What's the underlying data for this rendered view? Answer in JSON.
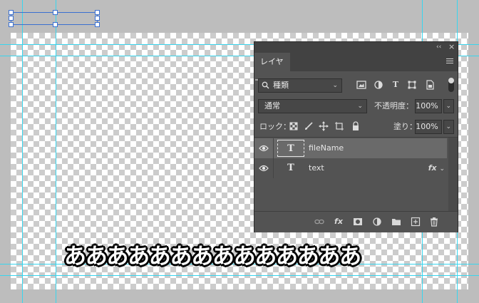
{
  "canvas": {
    "text": "ああああああああああああああ"
  },
  "panel": {
    "title_buttons": {
      "collapse": "‹‹",
      "close": "×"
    },
    "tab_label": "レイヤー",
    "filter": {
      "kind_value": "種類"
    },
    "blend": {
      "mode_value": "通常"
    },
    "opacity": {
      "label": "不透明度：",
      "value": "100%"
    },
    "lock": {
      "label": "ロック："
    },
    "fill": {
      "label": "塗り：",
      "value": "100%"
    },
    "layers": [
      {
        "name": "fileName",
        "type_glyph": "T",
        "selected": true,
        "fx": ""
      },
      {
        "name": "text",
        "type_glyph": "T",
        "selected": false,
        "fx": "fx"
      }
    ],
    "bottom_icons": [
      "link-icon",
      "fx-icon",
      "mask-icon",
      "adjustment-icon",
      "folder-icon",
      "new-layer-icon",
      "trash-icon"
    ],
    "bottom_fx_label": "fx",
    "filter_icons": [
      "image-filter-icon",
      "adjustment-filter-icon",
      "type-filter-icon",
      "shape-filter-icon",
      "smart-object-filter-icon"
    ],
    "lock_icons": [
      "lock-pixels-icon",
      "lock-paint-icon",
      "lock-position-icon",
      "lock-artboard-icon",
      "lock-all-icon"
    ]
  },
  "colors": {
    "guide": "#38d5ee",
    "selection": "#3a6fd0",
    "panel_bg": "#535353",
    "panel_header": "#424242",
    "selected_layer": "#6a6a6a"
  }
}
